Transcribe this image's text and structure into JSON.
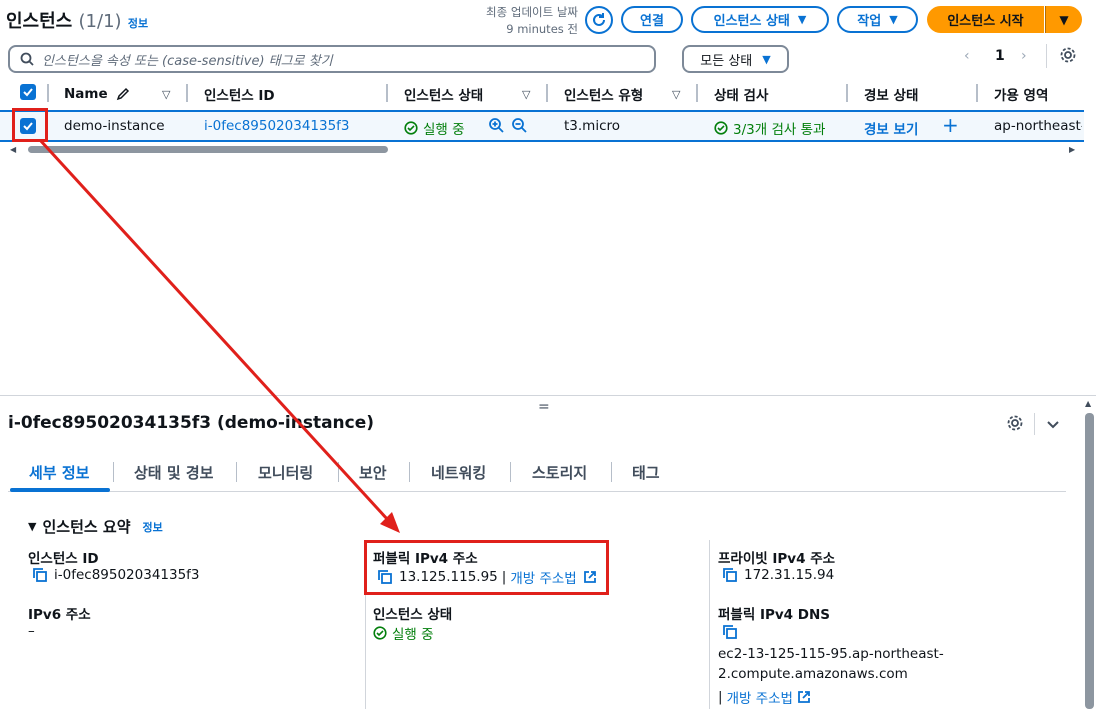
{
  "header": {
    "title": "인스턴스",
    "count": "(1/1)",
    "info": "정보",
    "last_update_label": "최종 업데이트 날짜",
    "last_update_value": "9 minutes 전",
    "connect": "연결",
    "instance_state": "인스턴스 상태",
    "actions": "작업",
    "launch": "인스턴스 시작"
  },
  "search": {
    "placeholder": "인스턴스을 속성 또는 (case-sensitive) 태그로 찾기"
  },
  "filter": {
    "selected": "모든 상태"
  },
  "pagination": {
    "page": "1"
  },
  "table": {
    "headers": [
      "Name",
      "인스턴스 ID",
      "인스턴스 상태",
      "인스턴스 유형",
      "상태 검사",
      "경보 상태",
      "가용 영역"
    ],
    "row": {
      "name": "demo-instance",
      "id": "i-0fec89502034135f3",
      "state": "실행 중",
      "type": "t3.micro",
      "check": "3/3개 검사 통과",
      "alarm": "경보 보기",
      "az": "ap-northeast-"
    }
  },
  "details": {
    "title": "i-0fec89502034135f3 (demo-instance)",
    "tabs": [
      "세부 정보",
      "상태 및 경보",
      "모니터링",
      "보안",
      "네트워킹",
      "스토리지",
      "태그"
    ],
    "section": "인스턴스 요약",
    "section_info": "정보",
    "instance_id_label": "인스턴스 ID",
    "instance_id": "i-0fec89502034135f3",
    "ipv6_label": "IPv6 주소",
    "ipv6": "–",
    "public_ipv4_label": "퍼블릭 IPv4 주소",
    "public_ipv4": "13.125.115.95",
    "open_address": "개방 주소법",
    "instance_state_label": "인스턴스 상태",
    "instance_state": "실행 중",
    "private_ipv4_label": "프라이빗 IPv4 주소",
    "private_ipv4": "172.31.15.94",
    "public_dns_label": "퍼블릭 IPv4 DNS",
    "public_dns_line1": "ec2-13-125-115-95.ap-northeast-",
    "public_dns_line2": "2.compute.amazonaws.com",
    "open_address2": "개방 주소법"
  },
  "colors": {
    "accent": "#0972d3",
    "primary": "#ff9900",
    "success": "#037f0c",
    "annotation": "#e0201b"
  },
  "icons": [
    "search-icon",
    "refresh-icon",
    "settings-icon",
    "copy-icon",
    "external-link-icon",
    "check-circle-icon",
    "zoom-in-icon",
    "zoom-out-icon",
    "pencil-icon",
    "chevron-down-icon"
  ]
}
